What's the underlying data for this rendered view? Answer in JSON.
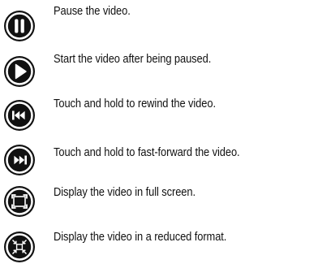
{
  "controls": [
    {
      "icon": "pause-icon",
      "description": "Pause the video."
    },
    {
      "icon": "play-icon",
      "description": "Start the video after being paused."
    },
    {
      "icon": "rewind-icon",
      "description": "Touch and hold to rewind the video."
    },
    {
      "icon": "fast-forward-icon",
      "description": "Touch and hold to fast-forward the video."
    },
    {
      "icon": "full-screen-icon",
      "description": "Display the video in full screen."
    },
    {
      "icon": "reduced-format-icon",
      "description": "Display the video in a reduced format."
    }
  ],
  "colors": {
    "icon_fill": "#111111",
    "icon_symbol": "#ffffff",
    "text": "#111111",
    "background": "#ffffff"
  }
}
